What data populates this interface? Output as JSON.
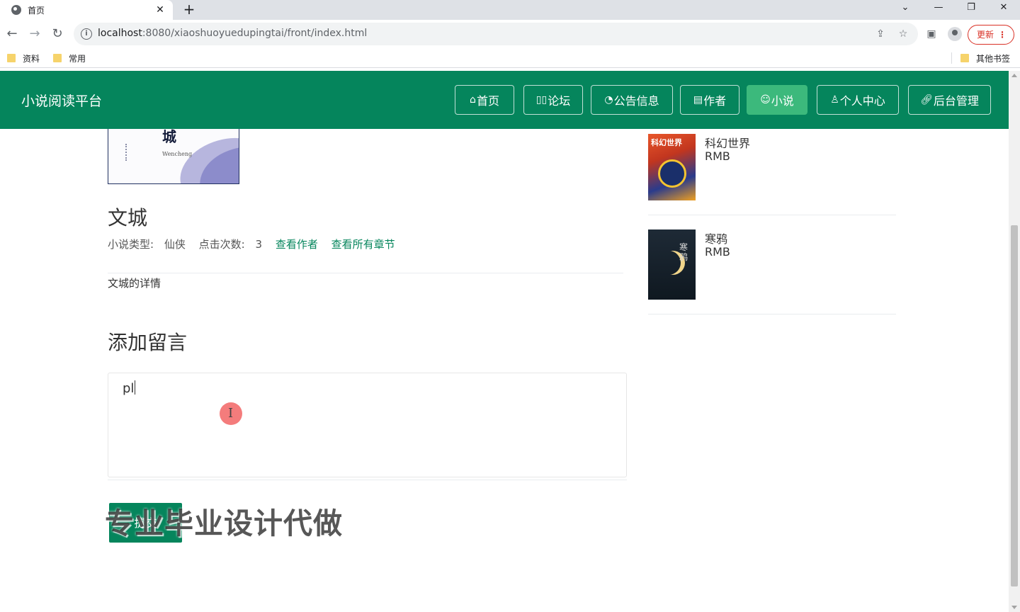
{
  "browser": {
    "tab_title": "首页",
    "url_host": "localhost",
    "url_rest": ":8080/xiaoshuoyuedupingtai/front/index.html",
    "update_label": "更新",
    "bookmarks": [
      "资料",
      "常用"
    ],
    "other_bookmarks": "其他书签"
  },
  "header": {
    "brand": "小说阅读平台",
    "nav": [
      {
        "label": "首页",
        "icon": "home-icon"
      },
      {
        "label": "论坛",
        "icon": "forum-icon"
      },
      {
        "label": "公告信息",
        "icon": "dashboard-icon"
      },
      {
        "label": "作者",
        "icon": "document-icon"
      },
      {
        "label": "小说",
        "icon": "smile-icon"
      },
      {
        "label": "个人中心",
        "icon": "user-icon"
      },
      {
        "label": "后台管理",
        "icon": "link-icon"
      }
    ],
    "active_nav": "小说"
  },
  "book": {
    "title": "文城",
    "cover_title": "城",
    "cover_signature": "Wencheng",
    "type_label": "小说类型:",
    "type_value": "仙侠",
    "clicks_label": "点击次数:",
    "clicks_value": "3",
    "view_author": "查看作者",
    "view_chapters": "查看所有章节",
    "detail": "文城的详情"
  },
  "comment": {
    "section_title": "添加留言",
    "input_value": "pl",
    "submit_label": "提交"
  },
  "watermark": "专业毕业设计代做",
  "sidebar": {
    "items": [
      {
        "name": "科幻世界",
        "price": "RMB",
        "cover_text": "科幻世界"
      },
      {
        "name": "寒鸦",
        "price": "RMB",
        "cover_text": "寒鸦"
      }
    ]
  },
  "colors": {
    "brand_green": "#05855c",
    "active_nav": "#3cb97c"
  }
}
